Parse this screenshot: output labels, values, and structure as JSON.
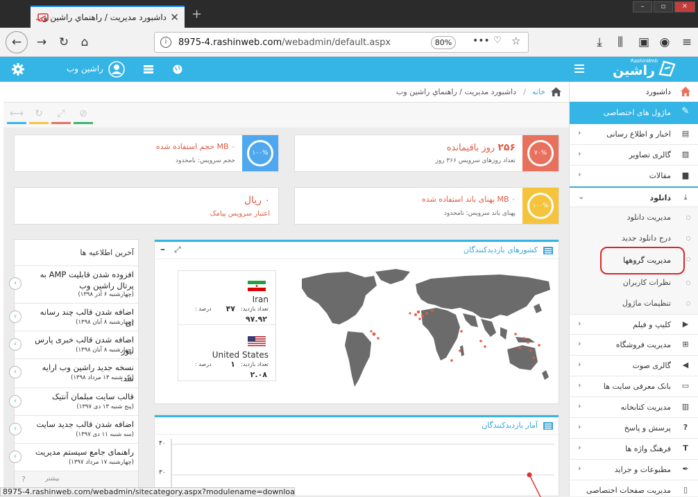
{
  "browser": {
    "tab_title": "داشبورد مديريت / راهنماي راشين و...",
    "url_host": "8975-4.rashinweb.com",
    "url_path": "/webadmin/default.aspx",
    "zoom": "80%",
    "status_url": "8975-4.rashinweb.com/webadmin/sitecategory.aspx?modulename=download"
  },
  "header": {
    "username": "راشين وب",
    "logo_text": "راشین وب",
    "logo_small": "RashinWeb"
  },
  "breadcrumb": {
    "home": "خانه",
    "separator": "/",
    "current": "داشبورد مديريت / راهنماي راشين وب"
  },
  "cards": {
    "days": {
      "value": "۲۵۶",
      "unit": "روز باقیمانده",
      "sub": "تعداد روزهای سرویس ۳۶۶ روز",
      "percent": "۷۰%",
      "color": "#e8705c"
    },
    "storage": {
      "value": "۰",
      "unit": "MB حجم استفاده شده",
      "sub": "حجم سرویس: نامحدود",
      "percent": "۱۰۰%",
      "color": "#4fa8ef"
    },
    "bandwidth": {
      "value": "۰",
      "unit": "MB پهنای باند استفاده شده",
      "sub": "پهنای باند سرویس: نامحدود",
      "percent": "۱۰۰%",
      "color": "#f5c43c"
    },
    "sms": {
      "value": "۰ ريال",
      "sub": "اعتبار سرويس پيامک"
    }
  },
  "countries_panel": {
    "title": "کشورهای بازدیدکنندگان",
    "countries": [
      {
        "name": "Iran",
        "visits_label": "تعداد بازدید:",
        "visits": "۴۷",
        "percent_label": "درصد :",
        "percent": "۹۷.۹۲"
      },
      {
        "name": "United States",
        "visits_label": "تعداد بازدید:",
        "visits": "۱",
        "percent_label": "درصد :",
        "percent": "۲.۰۸"
      }
    ]
  },
  "stats_panel": {
    "title": "آمار بازدیدکنندگان",
    "y_ticks": [
      "۴۰",
      "۳۰"
    ]
  },
  "news": {
    "header": "آخرین اطلاعیه ها",
    "more": "بیشتر",
    "items": [
      {
        "title": "افزوده شدن قابلیت AMP به پرتال راشین وب",
        "date": "(چهارشنبه ۶ آذر ۱۳۹۸)"
      },
      {
        "title": "اضافه شدن قالب چند رسانه ای",
        "date": "(چهارشنبه ۸ آبان ۱۳۹۸)"
      },
      {
        "title": "اضافه شدن قالب خبری پارس نیوز",
        "date": "(چهارشنبه ۸ آبان ۱۳۹۸)"
      },
      {
        "title": "نسخه جدید راشین وب ارایه شد.",
        "date": "(یک شنبه ۱۳ مرداد ۱۳۹۸)"
      },
      {
        "title": "قالب سایت مبلمان آنتیک",
        "date": "(پنج شنبه ۱۳ دی ۱۳۹۷)"
      },
      {
        "title": "اضافه شدن قالب جدید سایت",
        "date": "(سه شنبه ۱۱ دی ۱۳۹۷)"
      },
      {
        "title": "راهنمای جامع سیستم مدیریت",
        "date": "(چهارشنبه ۱۷ مرداد ۱۳۹۷)"
      }
    ]
  },
  "sidebar": {
    "dashboard": "داشبورد",
    "my_modules": "ماژول های اختصاصی",
    "items": [
      {
        "label": "اخبار و اطلاع رسانی",
        "icon": "newspaper-icon"
      },
      {
        "label": "گالری تصاویر",
        "icon": "image-icon"
      },
      {
        "label": "مقالات",
        "icon": "document-icon"
      }
    ],
    "download": {
      "label": "دانلود",
      "sub": [
        "مدیریت دانلود",
        "درج دانلود جدید",
        "مدیریت گروهها",
        "نظرات کاربران",
        "تنظیمات ماژول"
      ]
    },
    "items2": [
      {
        "label": "کلیپ و فیلم",
        "icon": "video-icon"
      },
      {
        "label": "مدیریت فروشگاه",
        "icon": "cart-icon"
      },
      {
        "label": "گالری صوت",
        "icon": "audio-icon"
      },
      {
        "label": "بانک معرفی سایت ها",
        "icon": "monitor-icon"
      },
      {
        "label": "مدیریت کتابخانه",
        "icon": "book-icon"
      },
      {
        "label": "پرسش و پاسخ",
        "icon": "question-icon"
      },
      {
        "label": "فرهنگ واژه ها",
        "icon": "text-icon"
      },
      {
        "label": "مطبوعات و جراید",
        "icon": "pin-icon"
      },
      {
        "label": "مدیریت صفحات اختصاصی",
        "icon": "page-icon"
      }
    ]
  }
}
